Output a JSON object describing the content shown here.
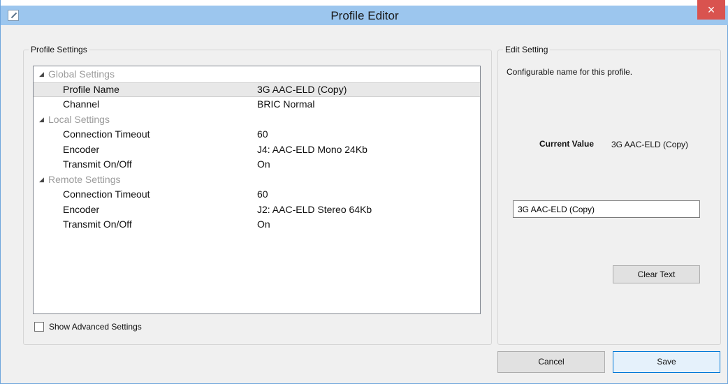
{
  "window": {
    "title": "Profile Editor",
    "close_glyph": "×",
    "icon": "edit-icon"
  },
  "profile_settings": {
    "label": "Profile Settings",
    "tree": [
      {
        "type": "category",
        "label": "Global Settings"
      },
      {
        "type": "property",
        "name": "Profile Name",
        "value": "3G AAC-ELD (Copy)",
        "selected": true
      },
      {
        "type": "property",
        "name": "Channel",
        "value": "BRIC Normal"
      },
      {
        "type": "category",
        "label": "Local Settings"
      },
      {
        "type": "property",
        "name": "Connection Timeout",
        "value": "60"
      },
      {
        "type": "property",
        "name": "Encoder",
        "value": "J4: AAC-ELD Mono 24Kb"
      },
      {
        "type": "property",
        "name": "Transmit On/Off",
        "value": "On"
      },
      {
        "type": "category",
        "label": "Remote Settings"
      },
      {
        "type": "property",
        "name": "Connection Timeout",
        "value": "60"
      },
      {
        "type": "property",
        "name": "Encoder",
        "value": "J2: AAC-ELD Stereo 64Kb"
      },
      {
        "type": "property",
        "name": "Transmit On/Off",
        "value": "On"
      }
    ],
    "show_advanced_label": "Show Advanced Settings",
    "show_advanced_checked": false
  },
  "edit_setting": {
    "label": "Edit Setting",
    "description": "Configurable name for this profile.",
    "current_value_label": "Current Value",
    "current_value": "3G AAC-ELD (Copy)",
    "input_value": "3G AAC-ELD (Copy)",
    "clear_button": "Clear Text"
  },
  "footer": {
    "cancel": "Cancel",
    "save": "Save"
  },
  "colors": {
    "titlebar": "#9cc6ee",
    "close": "#d9534f",
    "accent": "#0078d7"
  }
}
